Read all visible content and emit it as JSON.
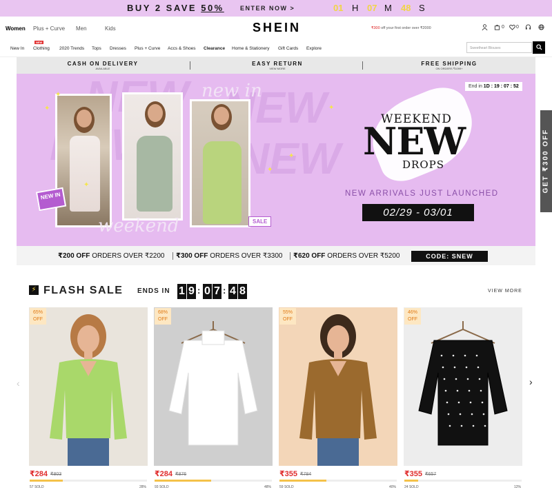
{
  "promo_bar": {
    "main_prefix": "BUY 2 SAVE ",
    "main_percent": "50%",
    "cta": "ENTER NOW >",
    "countdown": [
      {
        "value": "01",
        "unit": "H"
      },
      {
        "value": "07",
        "unit": "M"
      },
      {
        "value": "48",
        "unit": "S"
      }
    ]
  },
  "header": {
    "categories": [
      "Women",
      "Plus + Curve",
      "Men",
      "Kids"
    ],
    "logo": "SHEIN",
    "promo_amount": "₹300",
    "promo_text": " off your first order over ₹2000",
    "cart_count": "0",
    "wishlist_count": "0"
  },
  "nav": {
    "items": [
      "New In",
      "Clothing",
      "2020 Trends",
      "Tops",
      "Dresses",
      "Plus + Curve",
      "Accs & Shoes",
      "Clearance",
      "Home & Stationery",
      "Gift Cards",
      "Explore"
    ],
    "new_badge": "NEW",
    "search_placeholder": "Sweetheart Blouses"
  },
  "benefits": [
    {
      "title": "CASH ON DELIVERY",
      "sub": "AVAILABLE"
    },
    {
      "title": "EASY RETURN",
      "sub": "VIEW MORE"
    },
    {
      "title": "FREE SHIPPING",
      "sub": "ON ORDERS ₹1099+"
    }
  ],
  "hero": {
    "end_in_label": "End in ",
    "end_in_value": "1D : 19 : 07 : 52",
    "headline_top": "WEEKEND",
    "headline_main": "NEW",
    "headline_bottom": "DROPS",
    "subheadline": "NEW ARRIVALS JUST LAUNCHED",
    "dates": "02/29 - 03/01",
    "new_in_tag": "NEW IN",
    "sale_tag": "SALE",
    "script_top": "new in",
    "script_bottom": "weekend",
    "bg_word": "NEW"
  },
  "coupons": {
    "items": [
      {
        "amount": "₹200 OFF",
        "rest": " ORDERS OVER ₹2200"
      },
      {
        "amount": "₹300 OFF",
        "rest": " ORDERS OVER ₹3300"
      },
      {
        "amount": "₹620 OFF",
        "rest": " ORDERS OVER ₹5200"
      }
    ],
    "code": "CODE:  SNEW"
  },
  "side_tab": "GET ₹300 OFF",
  "flash_sale": {
    "title": "FLASH SALE",
    "ends_in": "ENDS IN",
    "timer_digits": [
      "1",
      "9",
      "0",
      "7",
      "4",
      "8"
    ],
    "view_more": "VIEW MORE"
  },
  "products": [
    {
      "discount": "65%",
      "off": "OFF",
      "price": "₹284",
      "old_price": "₹803",
      "sold": "57 SOLD",
      "sold_pct_label": "28%",
      "sold_fraction": 0.28,
      "color": "#a9d86a",
      "bg": "#e9e4dc"
    },
    {
      "discount": "68%",
      "off": "OFF",
      "price": "₹284",
      "old_price": "₹876",
      "sold": "93 SOLD",
      "sold_pct_label": "48%",
      "sold_fraction": 0.48,
      "color": "#ffffff",
      "bg": "#cfcfcf"
    },
    {
      "discount": "55%",
      "off": "OFF",
      "price": "₹355",
      "old_price": "₹784",
      "sold": "59 SOLD",
      "sold_pct_label": "40%",
      "sold_fraction": 0.4,
      "color": "#9b6a2e",
      "bg": "#f3d6b8"
    },
    {
      "discount": "46%",
      "off": "OFF",
      "price": "₹355",
      "old_price": "₹657",
      "sold": "24 SOLD",
      "sold_pct_label": "12%",
      "sold_fraction": 0.12,
      "color": "#111111",
      "bg": "#ededed"
    }
  ]
}
